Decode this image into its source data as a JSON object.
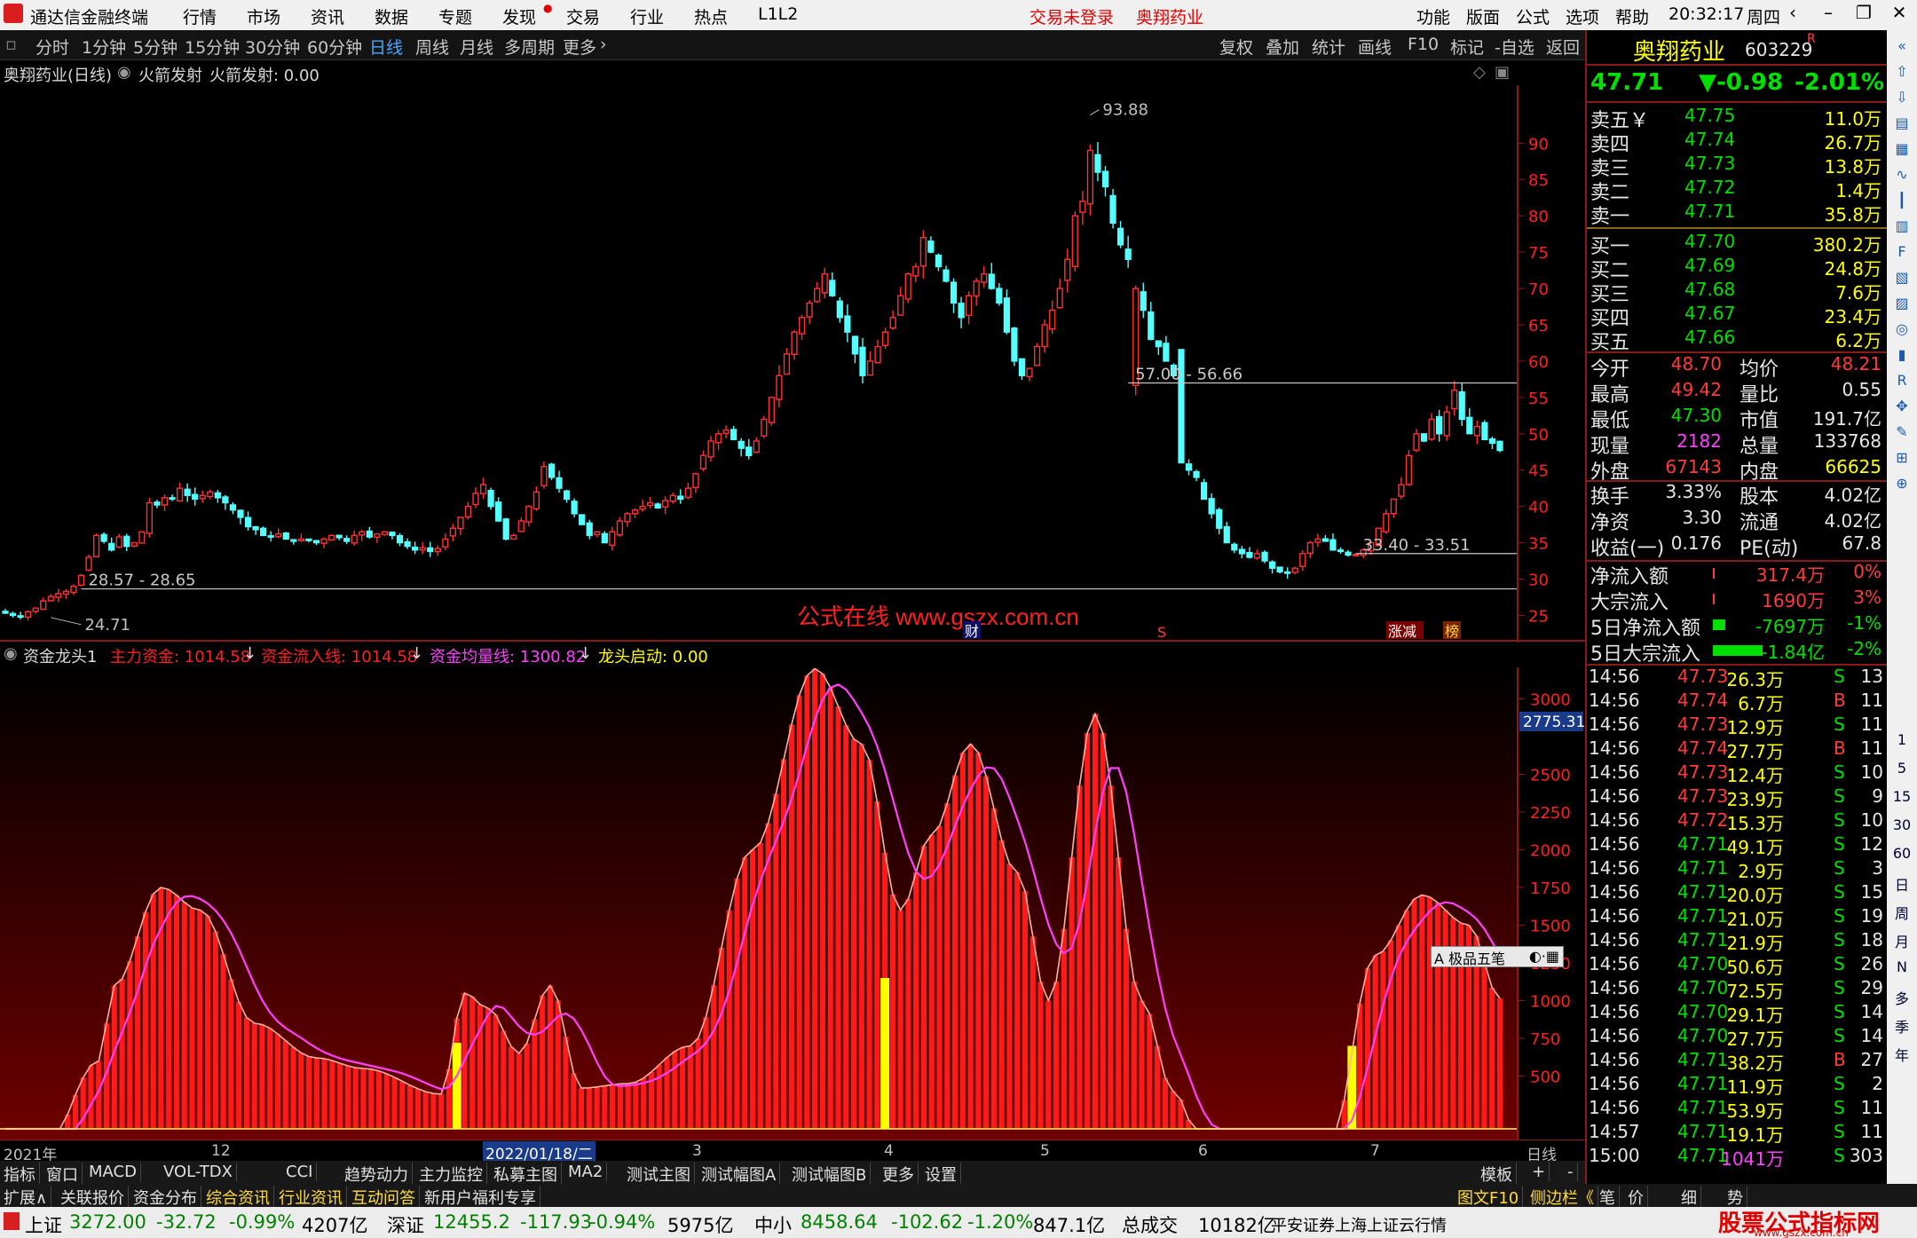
{
  "titlebar": {
    "app_name": "通达信金融终端",
    "menu": [
      "行情",
      "市场",
      "资讯",
      "数据",
      "专题",
      "发现",
      "交易",
      "行业",
      "热点",
      "L1L2"
    ],
    "login_status": "交易未登录",
    "stock_title": "奥翔药业",
    "right_menu": [
      "功能",
      "版面",
      "公式",
      "选项",
      "帮助"
    ],
    "time": "20:32:17",
    "weekday": "周四"
  },
  "periodbar": {
    "periods": [
      "分时",
      "1分钟",
      "5分钟",
      "15分钟",
      "30分钟",
      "60分钟",
      "日线",
      "周线",
      "月线",
      "多周期",
      "更多"
    ],
    "selected": "日线",
    "tools": [
      "复权",
      "叠加",
      "统计",
      "画线",
      "F10",
      "标记",
      "-自选",
      "返回"
    ]
  },
  "chart_header": {
    "stock": "奥翔药业(日线)",
    "indicator": "火箭发射",
    "indicator_value": "火箭发射: 0.00"
  },
  "main_chart_labels": {
    "high": "93.88",
    "low": "24.71",
    "gap1": "57.00 - 56.66",
    "gap2": "33.40 - 33.51",
    "gap3": "28.57 - 28.65",
    "watermark": "公式在线  www.gszx.com.cn",
    "badge_cai": "财",
    "badge_s": "S",
    "badge_zj": "涨减",
    "badge_bang": "榜"
  },
  "sub_header": {
    "name": "资金龙头1",
    "l1": "主力资金: 1014.58",
    "l2": "资金流入线: 1014.58",
    "l3": "资金均量线: 1300.82",
    "l4": "龙头启动: 0.00"
  },
  "sub_current_value": "2775.31",
  "ime_toolbar": "A 极品五笔",
  "date_axis": {
    "labels": [
      "2021年",
      "12",
      "2022/01/18/二",
      "3",
      "4",
      "5",
      "6",
      "7"
    ],
    "period": "日线"
  },
  "tabs1": [
    "指标",
    "窗口",
    "MACD",
    "VOL-TDX",
    "CCI",
    "趋势动力",
    "主力监控",
    "私募主图",
    "MA2",
    "测试主图",
    "测试幅图A",
    "测试幅图B",
    "更多",
    "设置"
  ],
  "tabs1_right": [
    "模板",
    "+",
    "-"
  ],
  "tabs2": [
    "扩展∧",
    "关联报价",
    "资金分布",
    "综合资讯",
    "行业资讯",
    "互动问答",
    "新用户福利专享"
  ],
  "tabs2_right": [
    "图文F10",
    "侧边栏《",
    "笔",
    "价",
    "细",
    "势"
  ],
  "statusbar": {
    "sh_label": "上证",
    "sh_val": "3272.00",
    "sh_chg": "-32.72",
    "sh_pct": "-0.99%",
    "sh_amt": "4207亿",
    "sz_label": "深证",
    "sz_val": "12455.2",
    "sz_chg": "-117.93",
    "sz_pct": "-0.94%",
    "sz_amt": "5975亿",
    "zx_label": "中小",
    "zx_val": "8458.64",
    "zx_chg": "-102.62",
    "zx_pct": "-1.20%",
    "zx_amt": "847.1亿",
    "total_label": "总成交",
    "total_amt": "10182亿",
    "broker": "平安证券上海上证云行情",
    "watermark_brand": "股票公式指标网",
    "watermark_url": "www.gszx.com.cn"
  },
  "quote": {
    "name": "奥翔药业",
    "code": "603229",
    "r": "R",
    "price": "47.71",
    "change": "▼-0.98",
    "pct": "-2.01%",
    "asks": [
      {
        "l": "卖五￥",
        "p": "47.75",
        "v": "11.0万"
      },
      {
        "l": "卖四",
        "p": "47.74",
        "v": "26.7万"
      },
      {
        "l": "卖三",
        "p": "47.73",
        "v": "13.8万"
      },
      {
        "l": "卖二",
        "p": "47.72",
        "v": "1.4万"
      },
      {
        "l": "卖一",
        "p": "47.71",
        "v": "35.8万"
      }
    ],
    "bids": [
      {
        "l": "买一",
        "p": "47.70",
        "v": "380.2万"
      },
      {
        "l": "买二",
        "p": "47.69",
        "v": "24.8万"
      },
      {
        "l": "买三",
        "p": "47.68",
        "v": "7.6万"
      },
      {
        "l": "买四",
        "p": "47.67",
        "v": "23.4万"
      },
      {
        "l": "买五",
        "p": "47.66",
        "v": "6.2万"
      }
    ],
    "stats": [
      {
        "a": "今开",
        "b": "48.70",
        "c": "均价",
        "d": "48.21"
      },
      {
        "a": "最高",
        "b": "49.42",
        "c": "量比",
        "d": "0.55"
      },
      {
        "a": "最低",
        "b": "47.30",
        "c": "市值",
        "d": "191.7亿"
      },
      {
        "a": "现量",
        "b": "2182",
        "c": "总量",
        "d": "133768"
      },
      {
        "a": "外盘",
        "b": "67143",
        "c": "内盘",
        "d": "66625"
      }
    ],
    "stats2": [
      {
        "a": "换手",
        "b": "3.33%",
        "c": "股本",
        "d": "4.02亿"
      },
      {
        "a": "净资",
        "b": "3.30",
        "c": "流通",
        "d": "4.02亿"
      },
      {
        "a": "收益(一)",
        "b": "0.176",
        "c": "PE(动)",
        "d": "67.8"
      }
    ],
    "flows": [
      {
        "a": "净流入额",
        "b": "317.4万",
        "c": "0%"
      },
      {
        "a": "大宗流入",
        "b": "1690万",
        "c": "3%"
      },
      {
        "a": "5日净流入额",
        "b": "-7697万",
        "c": "-1%"
      },
      {
        "a": "5日大宗流入",
        "b": "-1.84亿",
        "c": "-2%"
      }
    ],
    "ticks": [
      [
        "14:56",
        "47.73",
        "26.3万",
        "S",
        "13"
      ],
      [
        "14:56",
        "47.74",
        "6.7万",
        "B",
        "11"
      ],
      [
        "14:56",
        "47.73",
        "12.9万",
        "S",
        "11"
      ],
      [
        "14:56",
        "47.74",
        "27.7万",
        "B",
        "11"
      ],
      [
        "14:56",
        "47.73",
        "12.4万",
        "S",
        "10"
      ],
      [
        "14:56",
        "47.73",
        "23.9万",
        "S",
        "9"
      ],
      [
        "14:56",
        "47.72",
        "15.3万",
        "S",
        "10"
      ],
      [
        "14:56",
        "47.71",
        "49.1万",
        "S",
        "12"
      ],
      [
        "14:56",
        "47.71",
        "2.9万",
        "S",
        "3"
      ],
      [
        "14:56",
        "47.71",
        "20.0万",
        "S",
        "15"
      ],
      [
        "14:56",
        "47.71",
        "21.0万",
        "S",
        "19"
      ],
      [
        "14:56",
        "47.71",
        "21.9万",
        "S",
        "18"
      ],
      [
        "14:56",
        "47.70",
        "50.6万",
        "S",
        "26"
      ],
      [
        "14:56",
        "47.70",
        "72.5万",
        "S",
        "29"
      ],
      [
        "14:56",
        "47.70",
        "29.1万",
        "S",
        "14"
      ],
      [
        "14:56",
        "47.70",
        "27.7万",
        "S",
        "14"
      ],
      [
        "14:56",
        "47.71",
        "38.2万",
        "B",
        "27"
      ],
      [
        "14:56",
        "47.71",
        "11.9万",
        "S",
        "2"
      ],
      [
        "14:56",
        "47.71",
        "53.9万",
        "S",
        "11"
      ],
      [
        "14:57",
        "47.71",
        "19.1万",
        "S",
        "11"
      ],
      [
        "15:00",
        "47.71",
        "1041万",
        "S",
        "303"
      ]
    ]
  },
  "sidebar_icons": [
    "collapse-icon",
    "up-icon",
    "down-icon",
    "list-icon",
    "grid-icon",
    "chart-icon",
    "kline-icon",
    "table-icon",
    "f10-icon",
    "doc-icon",
    "news-icon",
    "ball-icon",
    "bar-icon",
    "rsi-icon",
    "move-icon",
    "pen-icon",
    "fs-icon",
    "link-icon"
  ],
  "sidebar_letters": [
    "1",
    "5",
    "15",
    "30",
    "60",
    "日",
    "周",
    "月",
    "N",
    "多",
    "季",
    "年"
  ],
  "chart_data": [
    {
      "type": "candlestick",
      "title": "奥翔药业(日线)",
      "y_ticks": [
        25,
        30,
        35,
        40,
        45,
        50,
        55,
        60,
        65,
        70,
        75,
        80,
        85,
        90
      ],
      "ylim": [
        22,
        97
      ],
      "annotated_high": 93.88,
      "annotated_low": 24.71,
      "gap_levels": [
        [
          56.66,
          57.0
        ],
        [
          33.4,
          33.51
        ],
        [
          28.57,
          28.65
        ]
      ],
      "closes": [
        25.3,
        25,
        24.8,
        25.5,
        26,
        27,
        27.6,
        28,
        28.3,
        29,
        30.5,
        33,
        36,
        35.2,
        34,
        35.8,
        34.5,
        35,
        36.5,
        40.5,
        40.2,
        41.2,
        41,
        42.5,
        41.5,
        41,
        41.5,
        42,
        41.2,
        40.5,
        39.5,
        38.5,
        37.2,
        36.8,
        36,
        35.8,
        36.2,
        35.5,
        35.2,
        35.5,
        35.3,
        35,
        35.5,
        36,
        35.7,
        35.2,
        36,
        36.5,
        35.8,
        36.2,
        36.5,
        36,
        35,
        34.5,
        34,
        34.3,
        33.8,
        34.2,
        35.5,
        37,
        38.5,
        40,
        41.8,
        43,
        40,
        38,
        35.5,
        36,
        38,
        40,
        42,
        45.5,
        44,
        42.5,
        41,
        39,
        37.5,
        36,
        36.5,
        35,
        36.5,
        38,
        39,
        39.5,
        40,
        40.5,
        39.8,
        40.8,
        41.5,
        41,
        42.5,
        44.5,
        47,
        49,
        50,
        50.5,
        49.2,
        48,
        47,
        49,
        52,
        55,
        58,
        61,
        64,
        66,
        68,
        70,
        72,
        69,
        66,
        64,
        61,
        58,
        60,
        62,
        64,
        66,
        69,
        72,
        73,
        77,
        75,
        73,
        71,
        68,
        66,
        69,
        71,
        72,
        70,
        68,
        64,
        60,
        58,
        59,
        62,
        65,
        67,
        70,
        74,
        80,
        82,
        89,
        86,
        84,
        79,
        76,
        74,
        70,
        67,
        63,
        62,
        60,
        58,
        46,
        45,
        44,
        41,
        39,
        37,
        35,
        34,
        33.5,
        33,
        33.5,
        32.5,
        31.5,
        31,
        30.8,
        31.5,
        33.5,
        35,
        35.5,
        35.2,
        34,
        33.8,
        33.3,
        33.4,
        34,
        35,
        37,
        39,
        41,
        43,
        47,
        50,
        49,
        52,
        50,
        53,
        56,
        52,
        50,
        51,
        49.2,
        48.7,
        47.7
      ]
    },
    {
      "type": "bar",
      "title": "资金龙头1",
      "series": [
        {
          "name": "主力资金",
          "color": "#ff2020",
          "last": 1014.58
        },
        {
          "name": "资金流入线",
          "color": "#ff2020",
          "last": 1014.58
        },
        {
          "name": "资金均量线",
          "color": "#ff40ff",
          "last": 1300.82
        },
        {
          "name": "龙头启动",
          "color": "#ffff00",
          "last": 0.0
        }
      ],
      "y_ticks": [
        500,
        750,
        1000,
        1250,
        1500,
        1750,
        2000,
        2250,
        2500,
        3000
      ],
      "ylim": [
        150,
        3150
      ],
      "current_label": 2775.31,
      "yellow_bars_at": [
        58,
        113,
        173
      ],
      "peaks": [
        [
          0,
          20
        ],
        [
          5,
          20
        ],
        [
          12,
          600
        ],
        [
          14,
          1100
        ],
        [
          20,
          1750
        ],
        [
          25,
          1600
        ],
        [
          32,
          850
        ],
        [
          40,
          620
        ],
        [
          46,
          550
        ],
        [
          56,
          380
        ],
        [
          59,
          1050
        ],
        [
          62,
          950
        ],
        [
          66,
          650
        ],
        [
          70,
          1100
        ],
        [
          74,
          420
        ],
        [
          80,
          450
        ],
        [
          88,
          700
        ],
        [
          96,
          2000
        ],
        [
          104,
          3200
        ],
        [
          110,
          2700
        ],
        [
          115,
          1600
        ],
        [
          119,
          2100
        ],
        [
          124,
          2700
        ],
        [
          130,
          1850
        ],
        [
          134,
          1000
        ],
        [
          140,
          2900
        ],
        [
          146,
          1000
        ],
        [
          150,
          400
        ],
        [
          154,
          20
        ],
        [
          162,
          20
        ],
        [
          166,
          150
        ],
        [
          170,
          20
        ],
        [
          176,
          1300
        ],
        [
          182,
          1700
        ],
        [
          188,
          1500
        ],
        [
          192,
          1014.58
        ]
      ]
    }
  ]
}
